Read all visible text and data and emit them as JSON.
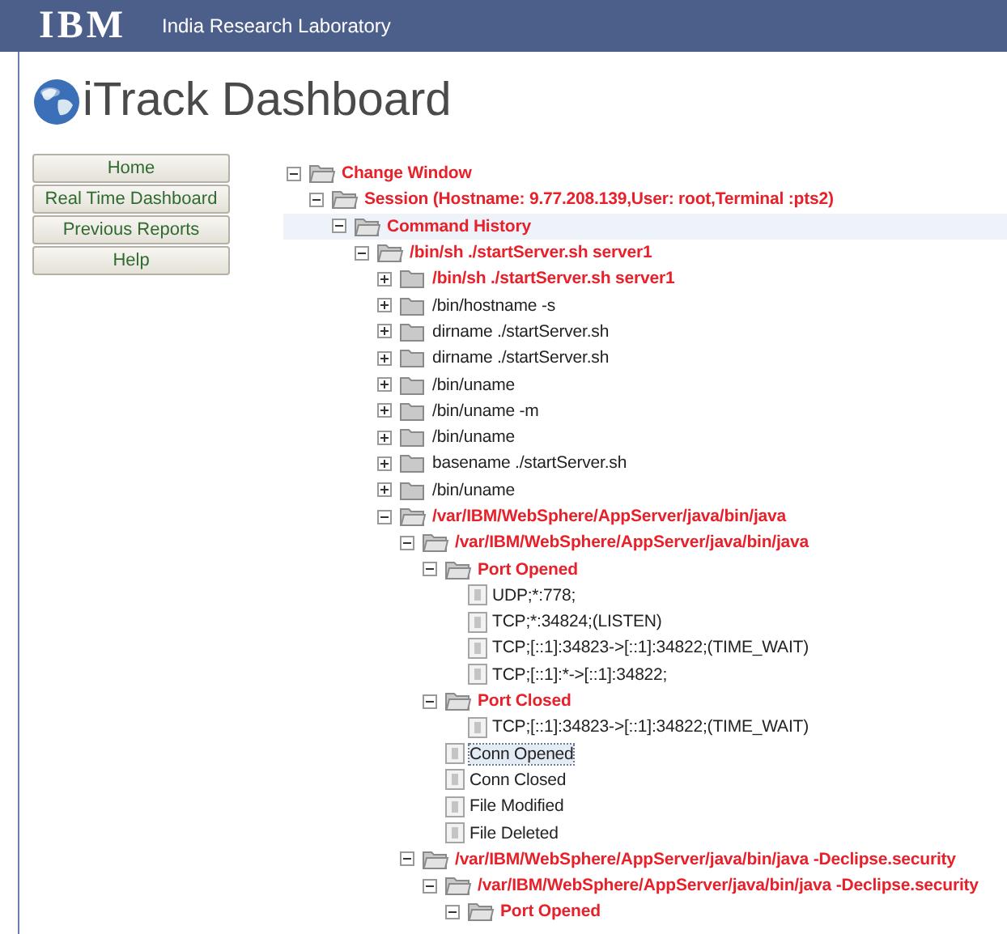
{
  "header": {
    "logo": "IBM",
    "lab": "India Research Laboratory"
  },
  "title": "iTrack Dashboard",
  "nav": [
    {
      "label": "Home"
    },
    {
      "label": "Real Time Dashboard"
    },
    {
      "label": "Previous Reports"
    },
    {
      "label": "Help"
    }
  ],
  "tree": [
    {
      "kind": "folder",
      "label": "Change Window",
      "flagged": true,
      "expanded": true,
      "selected": false,
      "children": [
        {
          "kind": "folder",
          "label": "Session (Hostname: 9.77.208.139,User: root,Terminal :pts2)",
          "flagged": true,
          "expanded": true,
          "selected": false,
          "children": [
            {
              "kind": "folder",
              "label": "Command History",
              "flagged": true,
              "expanded": true,
              "selected": false,
              "hovered": true,
              "children": [
                {
                  "kind": "folder",
                  "label": "/bin/sh ./startServer.sh server1",
                  "flagged": true,
                  "expanded": true,
                  "selected": false,
                  "children": [
                    {
                      "kind": "folder",
                      "label": "/bin/sh ./startServer.sh server1",
                      "flagged": true,
                      "expanded": false,
                      "selected": false
                    },
                    {
                      "kind": "folder",
                      "label": "/bin/hostname -s",
                      "flagged": false,
                      "expanded": false,
                      "selected": false
                    },
                    {
                      "kind": "folder",
                      "label": "dirname ./startServer.sh",
                      "flagged": false,
                      "expanded": false,
                      "selected": false
                    },
                    {
                      "kind": "folder",
                      "label": "dirname ./startServer.sh",
                      "flagged": false,
                      "expanded": false,
                      "selected": false
                    },
                    {
                      "kind": "folder",
                      "label": "/bin/uname",
                      "flagged": false,
                      "expanded": false,
                      "selected": false
                    },
                    {
                      "kind": "folder",
                      "label": "/bin/uname -m",
                      "flagged": false,
                      "expanded": false,
                      "selected": false
                    },
                    {
                      "kind": "folder",
                      "label": "/bin/uname",
                      "flagged": false,
                      "expanded": false,
                      "selected": false
                    },
                    {
                      "kind": "folder",
                      "label": "basename ./startServer.sh",
                      "flagged": false,
                      "expanded": false,
                      "selected": false
                    },
                    {
                      "kind": "folder",
                      "label": "/bin/uname",
                      "flagged": false,
                      "expanded": false,
                      "selected": false
                    },
                    {
                      "kind": "folder",
                      "label": "/var/IBM/WebSphere/AppServer/java/bin/java",
                      "flagged": true,
                      "expanded": true,
                      "selected": false,
                      "children": [
                        {
                          "kind": "folder",
                          "label": "/var/IBM/WebSphere/AppServer/java/bin/java",
                          "flagged": true,
                          "expanded": true,
                          "selected": false,
                          "children": [
                            {
                              "kind": "folder",
                              "label": "Port Opened",
                              "flagged": true,
                              "expanded": true,
                              "selected": false,
                              "children": [
                                {
                                  "kind": "file",
                                  "label": "UDP;*:778;",
                                  "flagged": false,
                                  "selected": false
                                },
                                {
                                  "kind": "file",
                                  "label": "TCP;*:34824;(LISTEN)",
                                  "flagged": false,
                                  "selected": false
                                },
                                {
                                  "kind": "file",
                                  "label": "TCP;[::1]:34823->[::1]:34822;(TIME_WAIT)",
                                  "flagged": false,
                                  "selected": false
                                },
                                {
                                  "kind": "file",
                                  "label": "TCP;[::1]:*->[::1]:34822;",
                                  "flagged": false,
                                  "selected": false
                                }
                              ]
                            },
                            {
                              "kind": "folder",
                              "label": "Port Closed",
                              "flagged": true,
                              "expanded": true,
                              "selected": false,
                              "children": [
                                {
                                  "kind": "file",
                                  "label": "TCP;[::1]:34823->[::1]:34822;(TIME_WAIT)",
                                  "flagged": false,
                                  "selected": false
                                }
                              ]
                            },
                            {
                              "kind": "file",
                              "label": "Conn Opened",
                              "flagged": false,
                              "selected": true
                            },
                            {
                              "kind": "file",
                              "label": "Conn Closed",
                              "flagged": false,
                              "selected": false
                            },
                            {
                              "kind": "file",
                              "label": "File Modified",
                              "flagged": false,
                              "selected": false
                            },
                            {
                              "kind": "file",
                              "label": "File Deleted",
                              "flagged": false,
                              "selected": false
                            }
                          ]
                        },
                        {
                          "kind": "folder",
                          "label": "/var/IBM/WebSphere/AppServer/java/bin/java -Declipse.security",
                          "flagged": true,
                          "expanded": true,
                          "selected": false,
                          "children": [
                            {
                              "kind": "folder",
                              "label": "/var/IBM/WebSphere/AppServer/java/bin/java -Declipse.security",
                              "flagged": true,
                              "expanded": true,
                              "selected": false,
                              "children": [
                                {
                                  "kind": "folder",
                                  "label": "Port Opened",
                                  "flagged": true,
                                  "expanded": true,
                                  "selected": false
                                }
                              ]
                            }
                          ]
                        }
                      ]
                    }
                  ]
                }
              ]
            }
          ]
        }
      ]
    }
  ]
}
